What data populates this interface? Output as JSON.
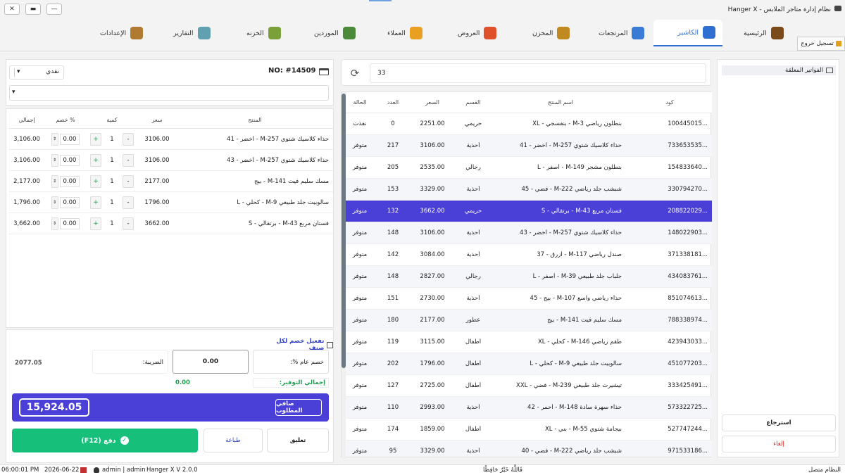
{
  "window": {
    "title": "نظام إدارة متاجر الملابس - Hanger X",
    "close": "✕",
    "restore": "▬",
    "minimize": "—"
  },
  "nav": {
    "items": [
      {
        "label": "الرئيسية",
        "color": "#7a4a1a"
      },
      {
        "label": "الكاشير",
        "color": "#2f6fd0"
      },
      {
        "label": "المرتجعات",
        "color": "#3a7bd5"
      },
      {
        "label": "المخزن",
        "color": "#c08a20"
      },
      {
        "label": "العروض",
        "color": "#e0502a"
      },
      {
        "label": "العملاء",
        "color": "#e9a020"
      },
      {
        "label": "الموردين",
        "color": "#4a8a3a"
      },
      {
        "label": "الخزنه",
        "color": "#7aa03a"
      },
      {
        "label": "التقارير",
        "color": "#60a0b0"
      },
      {
        "label": "الإعدادات",
        "color": "#b07a30"
      }
    ],
    "logout": "تسجيل خروج"
  },
  "held": {
    "title": "الفواتير المعلقة",
    "restore": "استرجاع",
    "cancel": "إلغاء"
  },
  "products": {
    "search_value": "33",
    "headers": {
      "code": "كود",
      "name": "اسم المنتج",
      "dept": "القسم",
      "price": "السعر",
      "qty": "العدد",
      "status": "الحالة"
    },
    "rows": [
      {
        "code": "100445015...",
        "name": "بنطلون رياضي M-3 - بنفسجي - XL",
        "dept": "حريمي",
        "price": "2251.00",
        "qty": "0",
        "status": "نفذت"
      },
      {
        "code": "733653535...",
        "name": "حذاء كلاسيك شتوي M-257 - أخضر - 41",
        "dept": "أحذية",
        "price": "3106.00",
        "qty": "217",
        "status": "متوفر"
      },
      {
        "code": "154833640...",
        "name": "بنطلون مشجر M-149 - أصفر - L",
        "dept": "رجالي",
        "price": "2535.00",
        "qty": "205",
        "status": "متوفر"
      },
      {
        "code": "330794270...",
        "name": "شبشب جلد رياضي M-222 - فضي - 45",
        "dept": "أحذية",
        "price": "3329.00",
        "qty": "153",
        "status": "متوفر"
      },
      {
        "code": "208822029...",
        "name": "فستان مربع M-43 - برتقالي - S",
        "dept": "حريمي",
        "price": "3662.00",
        "qty": "132",
        "status": "متوفر"
      },
      {
        "code": "148022903...",
        "name": "حذاء كلاسيك شتوي M-257 - أخضر - 43",
        "dept": "أحذية",
        "price": "3106.00",
        "qty": "148",
        "status": "متوفر"
      },
      {
        "code": "371338181...",
        "name": "صندل رياضي M-117 - أزرق - 37",
        "dept": "أحذية",
        "price": "3084.00",
        "qty": "142",
        "status": "متوفر"
      },
      {
        "code": "434083761...",
        "name": "جلباب جلد طبيعي M-39 - أصفر - L",
        "dept": "رجالي",
        "price": "2827.00",
        "qty": "148",
        "status": "متوفر"
      },
      {
        "code": "851074613...",
        "name": "حذاء رياضي واسع M-107 - بيج - 45",
        "dept": "أحذية",
        "price": "2730.00",
        "qty": "151",
        "status": "متوفر"
      },
      {
        "code": "788338974...",
        "name": "مسك سليم فيت M-141 - بيج",
        "dept": "عطور",
        "price": "2177.00",
        "qty": "180",
        "status": "متوفر"
      },
      {
        "code": "423943033...",
        "name": "طقم رياضي M-146 - كحلي - XL",
        "dept": "أطفال",
        "price": "3115.00",
        "qty": "119",
        "status": "متوفر"
      },
      {
        "code": "451077203...",
        "name": "سالوبيت جلد طبيعي M-9 - كحلي - L",
        "dept": "أطفال",
        "price": "1796.00",
        "qty": "202",
        "status": "متوفر"
      },
      {
        "code": "333425491...",
        "name": "تيشيرت جلد طبيعي M-239 - فضي - XXL",
        "dept": "أطفال",
        "price": "2725.00",
        "qty": "127",
        "status": "متوفر"
      },
      {
        "code": "573322725...",
        "name": "حذاء سهرة سادة M-148 - أحمر - 42",
        "dept": "أحذية",
        "price": "2993.00",
        "qty": "110",
        "status": "متوفر"
      },
      {
        "code": "527747244...",
        "name": "بيجامة شتوي M-55 - بني - XL",
        "dept": "أطفال",
        "price": "1859.00",
        "qty": "174",
        "status": "متوفر"
      },
      {
        "code": "971533186...",
        "name": "شبشب جلد رياضي M-222 - فضي - 40",
        "dept": "أحذية",
        "price": "3329.00",
        "qty": "95",
        "status": "متوفر"
      }
    ]
  },
  "invoice": {
    "number": "NO: #14509",
    "payment_type": "نقدي",
    "headers": {
      "product": "المنتج",
      "price": "سعر",
      "qty": "كمية",
      "discount": "خصم %",
      "total": "إجمالي"
    },
    "rows": [
      {
        "product": "حذاء كلاسيك شتوي M-257 - أخضر - 41",
        "price": "3106.00",
        "qty": "1",
        "discount": "0.00",
        "total": "3,106.00"
      },
      {
        "product": "حذاء كلاسيك شتوي M-257 - أخضر - 43",
        "price": "3106.00",
        "qty": "1",
        "discount": "0.00",
        "total": "3,106.00"
      },
      {
        "product": "مسك سليم فيت M-141 - بيج",
        "price": "2177.00",
        "qty": "1",
        "discount": "0.00",
        "total": "2,177.00"
      },
      {
        "product": "سالوبيت جلد طبيعي M-9 - كحلي - L",
        "price": "1796.00",
        "qty": "1",
        "discount": "0.00",
        "total": "1,796.00"
      },
      {
        "product": "فستان مربع M-43 - برتقالي - S",
        "price": "3662.00",
        "qty": "1",
        "discount": "0.00",
        "total": "3,662.00"
      }
    ],
    "per_item_discount": "تفعيل خصم لكل صنف",
    "general_discount_label": "خصم عام %:",
    "tax_label": "الضريبة:",
    "tax_value": "0.00",
    "side_value": "2077.05",
    "savings_label": "إجمالي التوفير:",
    "savings_value": "0.00",
    "net_label": "صافي المطلوب",
    "net_value": "15,924.05",
    "pay_label": "دفع (F12)",
    "print_label": "طباعة",
    "hold_label": "تعليق"
  },
  "status": {
    "connection": "النظام متصل",
    "quote": "فَاللَّهُ خَيْرٌ حَافِظًا",
    "version": "Hanger X V 2.0.0",
    "user": "admin | admin",
    "date": "2026-06-22",
    "time": "06:00:01 PM"
  }
}
